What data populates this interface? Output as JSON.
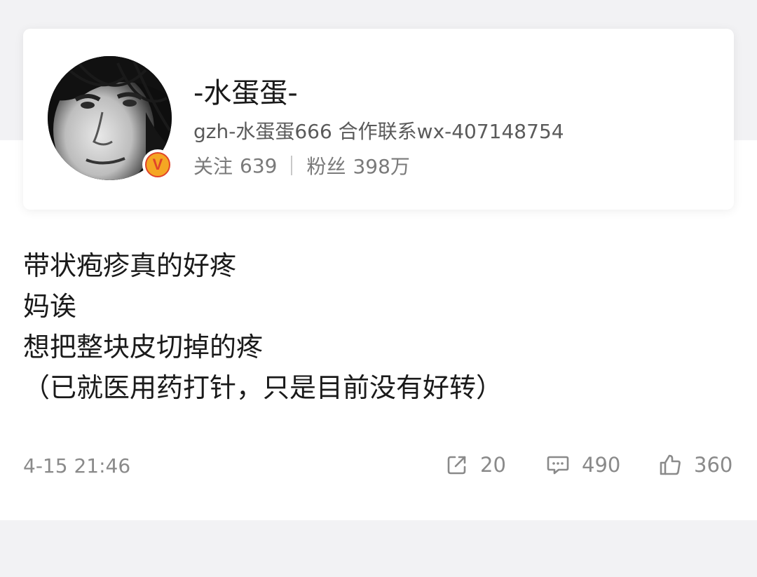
{
  "profile": {
    "username": "-水蛋蛋-",
    "bio": "gzh-水蛋蛋666 合作联系wx-407148754",
    "following_label": "关注",
    "following_count": "639",
    "followers_label": "粉丝",
    "followers_count": "398万",
    "verified_badge": "V"
  },
  "post": {
    "lines": [
      "带状疱疹真的好疼",
      "妈诶",
      "想把整块皮切掉的疼",
      "（已就医用药打针，只是目前没有好转）"
    ],
    "timestamp": "4-15 21:46"
  },
  "actions": {
    "repost_count": "20",
    "comment_count": "490",
    "like_count": "360"
  },
  "icons": [
    "verified-icon",
    "repost-icon",
    "comment-icon",
    "like-icon"
  ],
  "colors": {
    "badge_fill": "#f5a623",
    "badge_accent": "#e0442a",
    "secondary_text": "#8a8a8a"
  }
}
